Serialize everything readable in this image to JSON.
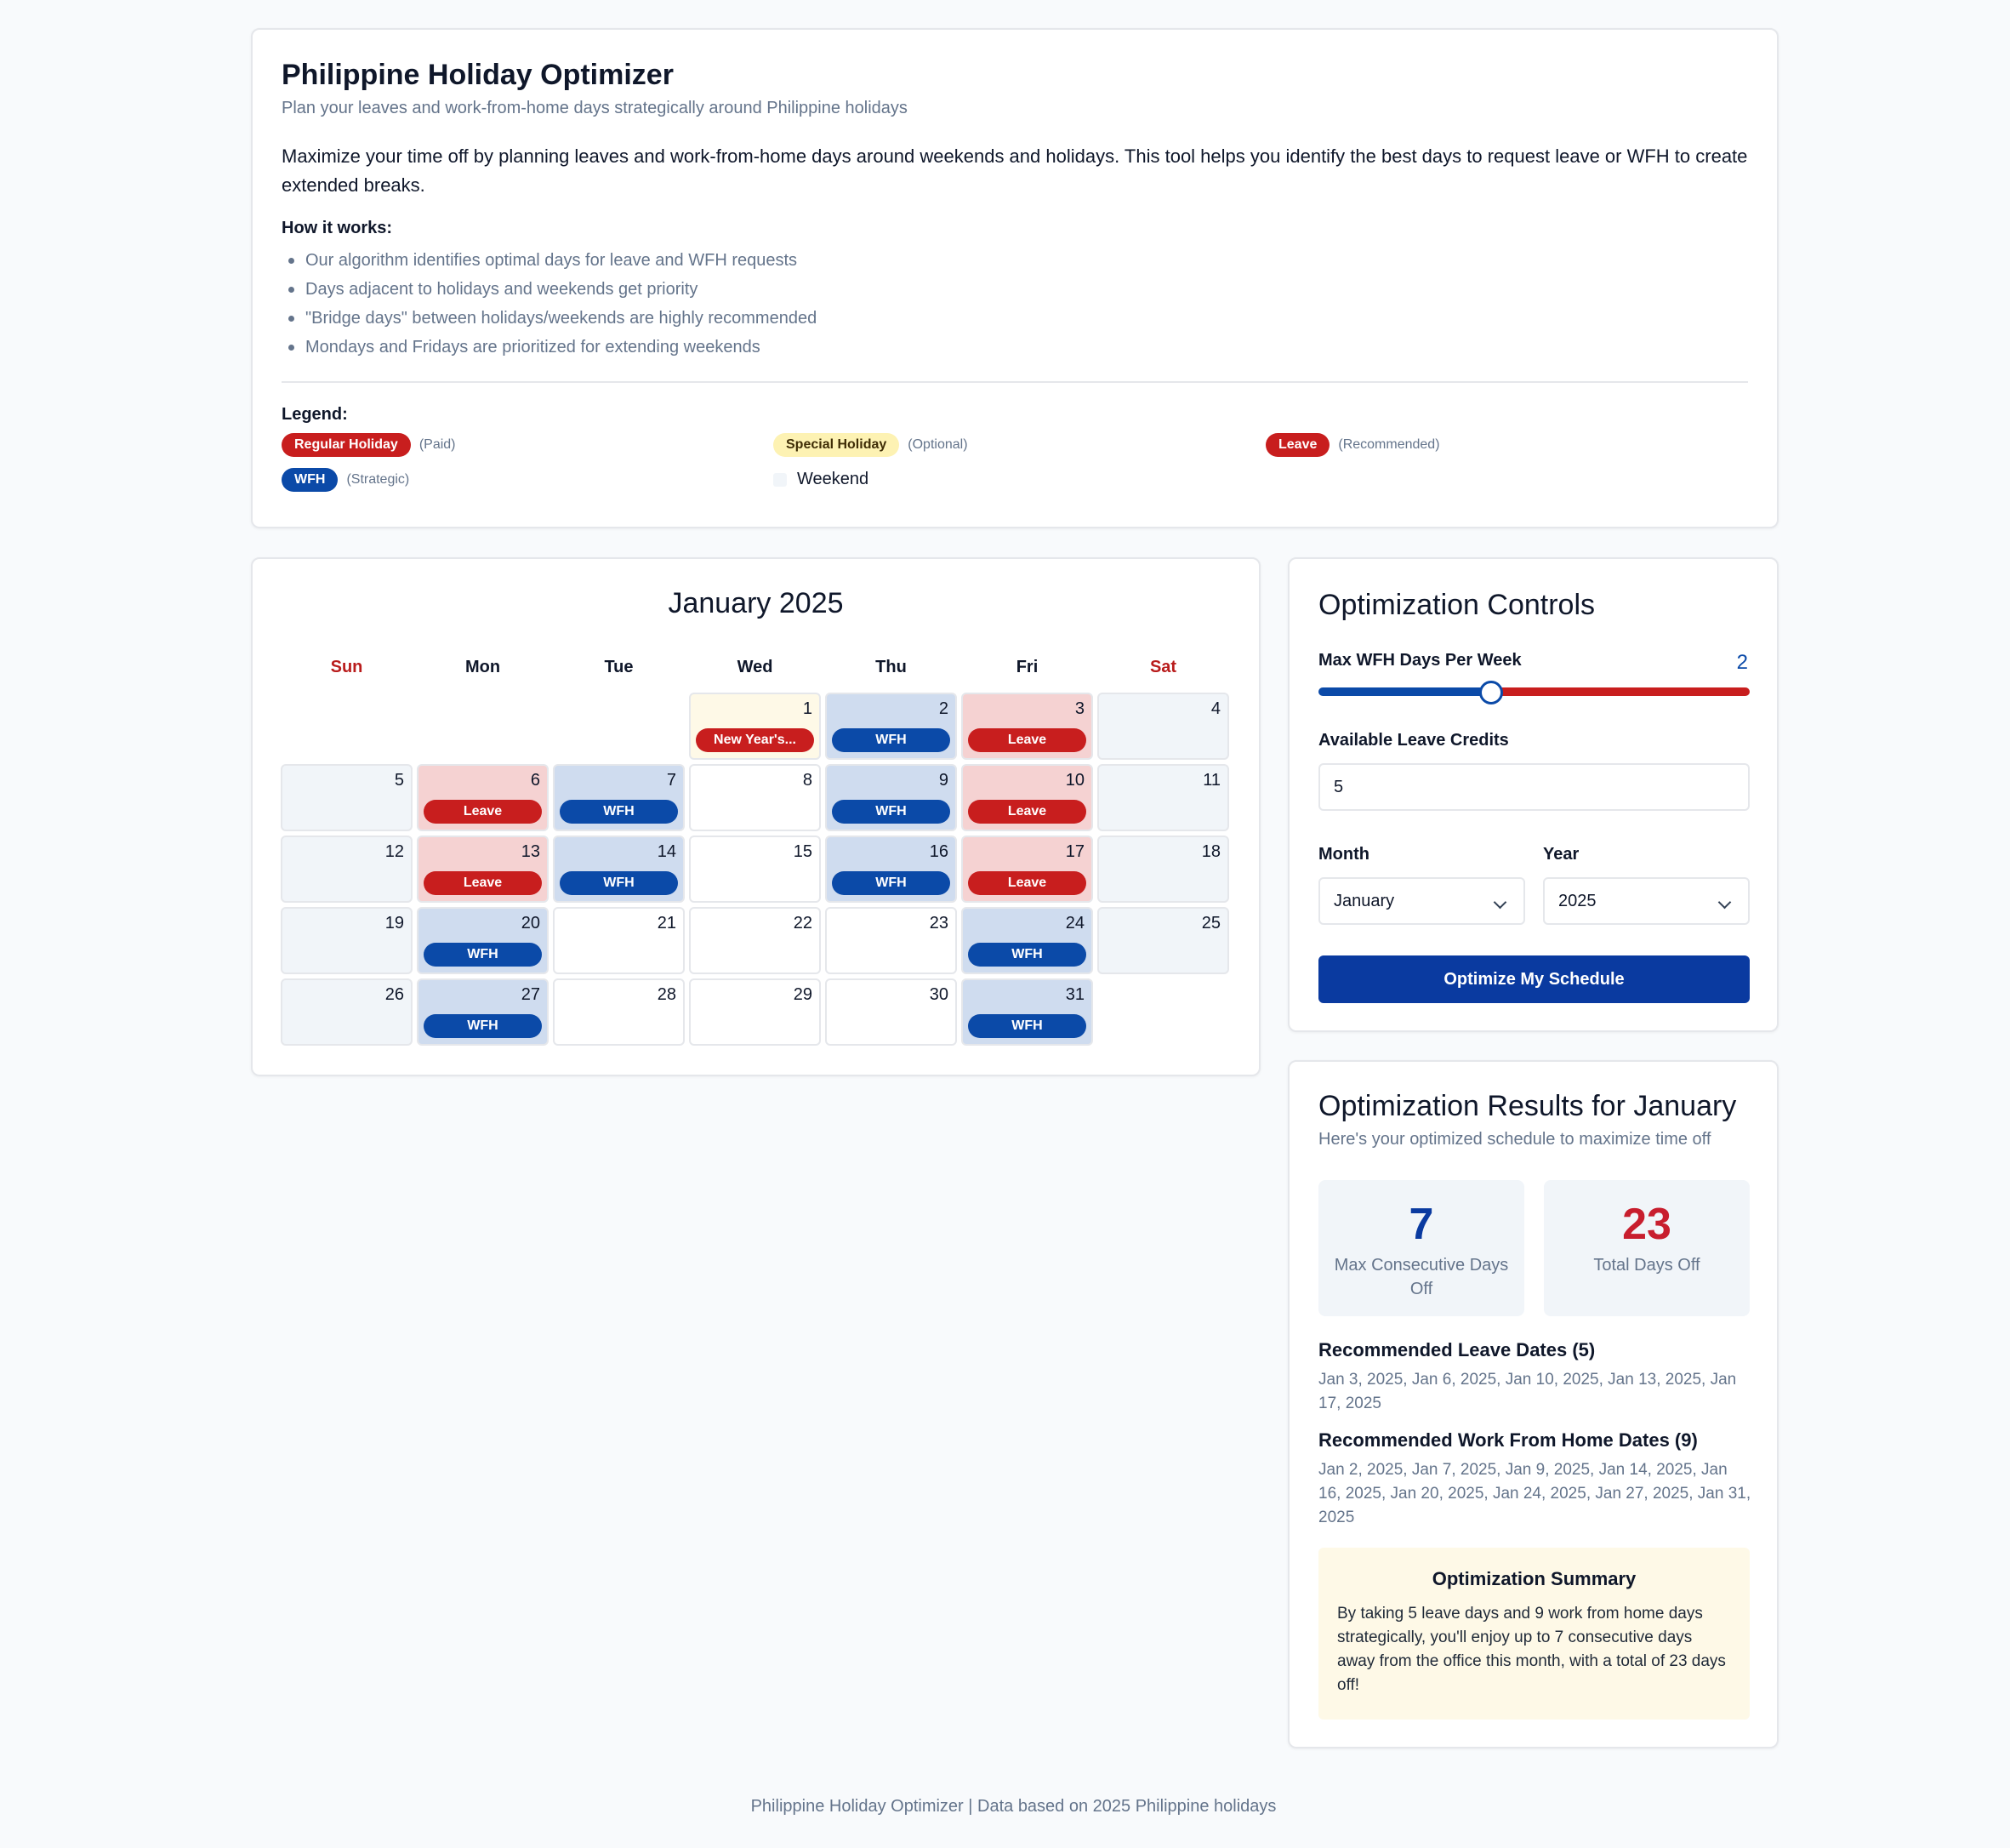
{
  "header": {
    "title": "Philippine Holiday Optimizer",
    "subtitle": "Plan your leaves and work-from-home days strategically around Philippine holidays",
    "intro": "Maximize your time off by planning leaves and work-from-home days around weekends and holidays. This tool helps you identify the best days to request leave or WFH to create extended breaks.",
    "how_title": "How it works:",
    "how_items": [
      "Our algorithm identifies optimal days for leave and WFH requests",
      "Days adjacent to holidays and weekends get priority",
      "\"Bridge days\" between holidays/weekends are highly recommended",
      "Mondays and Fridays are prioritized for extending weekends"
    ],
    "legend_title": "Legend:",
    "legend": {
      "regular_holiday": "Regular Holiday",
      "regular_note": "(Paid)",
      "special_holiday": "Special Holiday",
      "special_note": "(Optional)",
      "leave": "Leave",
      "leave_note": "(Recommended)",
      "wfh": "WFH",
      "wfh_note": "(Strategic)",
      "weekend": "Weekend"
    }
  },
  "calendar": {
    "title": "January 2025",
    "weekdays": [
      "Sun",
      "Mon",
      "Tue",
      "Wed",
      "Thu",
      "Fri",
      "Sat"
    ],
    "days": [
      {
        "day": "1",
        "type": "holiday",
        "tag": "New Year's..."
      },
      {
        "day": "2",
        "type": "wfh",
        "tag": "WFH"
      },
      {
        "day": "3",
        "type": "leave",
        "tag": "Leave"
      },
      {
        "day": "4",
        "type": "weekend",
        "tag": ""
      },
      {
        "day": "5",
        "type": "weekend",
        "tag": ""
      },
      {
        "day": "6",
        "type": "leave",
        "tag": "Leave"
      },
      {
        "day": "7",
        "type": "wfh",
        "tag": "WFH"
      },
      {
        "day": "8",
        "type": "normal",
        "tag": ""
      },
      {
        "day": "9",
        "type": "wfh",
        "tag": "WFH"
      },
      {
        "day": "10",
        "type": "leave",
        "tag": "Leave"
      },
      {
        "day": "11",
        "type": "weekend",
        "tag": ""
      },
      {
        "day": "12",
        "type": "weekend",
        "tag": ""
      },
      {
        "day": "13",
        "type": "leave",
        "tag": "Leave"
      },
      {
        "day": "14",
        "type": "wfh",
        "tag": "WFH"
      },
      {
        "day": "15",
        "type": "normal",
        "tag": ""
      },
      {
        "day": "16",
        "type": "wfh",
        "tag": "WFH"
      },
      {
        "day": "17",
        "type": "leave",
        "tag": "Leave"
      },
      {
        "day": "18",
        "type": "weekend",
        "tag": ""
      },
      {
        "day": "19",
        "type": "weekend",
        "tag": ""
      },
      {
        "day": "20",
        "type": "wfh",
        "tag": "WFH"
      },
      {
        "day": "21",
        "type": "normal",
        "tag": ""
      },
      {
        "day": "22",
        "type": "normal",
        "tag": ""
      },
      {
        "day": "23",
        "type": "normal",
        "tag": ""
      },
      {
        "day": "24",
        "type": "wfh",
        "tag": "WFH"
      },
      {
        "day": "25",
        "type": "weekend",
        "tag": ""
      },
      {
        "day": "26",
        "type": "weekend",
        "tag": ""
      },
      {
        "day": "27",
        "type": "wfh",
        "tag": "WFH"
      },
      {
        "day": "28",
        "type": "normal",
        "tag": ""
      },
      {
        "day": "29",
        "type": "normal",
        "tag": ""
      },
      {
        "day": "30",
        "type": "normal",
        "tag": ""
      },
      {
        "day": "31",
        "type": "wfh",
        "tag": "WFH"
      }
    ]
  },
  "controls": {
    "title": "Optimization Controls",
    "wfh_label": "Max WFH Days Per Week",
    "wfh_value": "2",
    "wfh_slider_fraction": 0.4,
    "leave_label": "Available Leave Credits",
    "leave_value": "5",
    "month_label": "Month",
    "month_value": "January",
    "year_label": "Year",
    "year_value": "2025",
    "button": "Optimize My Schedule"
  },
  "results": {
    "title": "Optimization Results for January",
    "subtitle": "Here's your optimized schedule to maximize time off",
    "consecutive_value": "7",
    "consecutive_label": "Max Consecutive Days Off",
    "total_value": "23",
    "total_label": "Total Days Off",
    "leave_title": "Recommended Leave Dates (5)",
    "leave_dates": "Jan 3, 2025, Jan 6, 2025, Jan 10, 2025, Jan 13, 2025, Jan 17, 2025",
    "wfh_title": "Recommended Work From Home Dates (9)",
    "wfh_dates": "Jan 2, 2025, Jan 7, 2025, Jan 9, 2025, Jan 14, 2025, Jan 16, 2025, Jan 20, 2025, Jan 24, 2025, Jan 27, 2025, Jan 31, 2025",
    "summary_title": "Optimization Summary",
    "summary_text": "By taking 5 leave days and 9 work from home days strategically, you'll enjoy up to 7 consecutive days away from the office this month, with a total of 23 days off!"
  },
  "footer": "Philippine Holiday Optimizer | Data based on 2025 Philippine holidays",
  "colors": {
    "primary_blue": "#0b4aa8",
    "accent_red": "#c81e1e",
    "holiday_yellow": "#fef9e7"
  }
}
